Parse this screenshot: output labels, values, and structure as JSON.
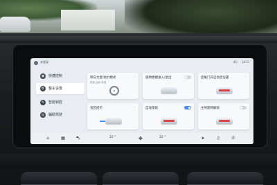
{
  "status": {
    "username": "未登录",
    "signal": "4G",
    "time": "14:11"
  },
  "sidebar": {
    "items": [
      {
        "label": "快捷控制",
        "icon": "quick-control-icon",
        "active": false
      },
      {
        "label": "整车设置",
        "icon": "vehicle-settings-icon",
        "active": true
      },
      {
        "label": "智能钥匙",
        "icon": "smart-key-icon",
        "active": false
      },
      {
        "label": "辅助驾驶",
        "icon": "driver-assist-icon",
        "active": false
      }
    ]
  },
  "cards": [
    {
      "title": "转向力度/助力模式",
      "sub": "舒适  运动  标准",
      "control": "more",
      "illustration": "steering-wheel-icon"
    },
    {
      "title": "座椅便捷进入/退出",
      "sub": "",
      "control": "toggle-off",
      "illustration": "seat-icon"
    },
    {
      "title": "后尾门开启高度设置",
      "sub": "",
      "control": "more",
      "illustration": "tailgate-icon"
    },
    {
      "title": "盲区提示",
      "sub": "",
      "control": "more",
      "illustration": "car-blue-icon"
    },
    {
      "title": "自动落锁",
      "sub": "",
      "control": "toggle-on",
      "illustration": "car-red-icon"
    },
    {
      "title": "主驾座椅解锁",
      "sub": "",
      "control": "toggle-off",
      "illustration": "car-red-icon"
    }
  ],
  "bottom_bar": {
    "home": "⌂",
    "apps": "▦",
    "car": "⛍",
    "left_temp": "22 °",
    "fan": "✤",
    "right_temp": "22 °",
    "navigation": "➤",
    "music": "♫",
    "phone": "✆"
  },
  "colors": {
    "accent": "#4a8df0",
    "warning": "#d8484b",
    "screen_bg": "#e9edf1"
  }
}
